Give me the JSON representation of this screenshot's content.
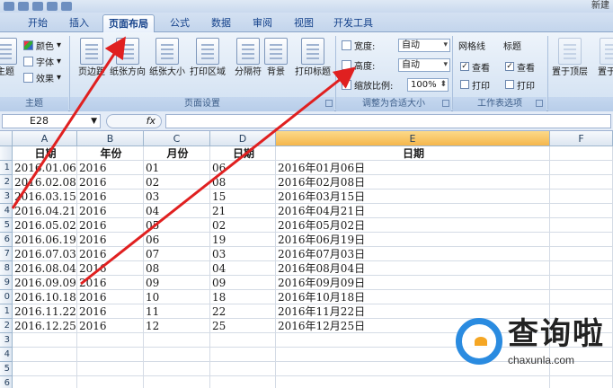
{
  "titlebar": {
    "title": "新建"
  },
  "tabs": [
    {
      "label": "开始"
    },
    {
      "label": "插入"
    },
    {
      "label": "页面布局",
      "active": true
    },
    {
      "label": "公式"
    },
    {
      "label": "数据"
    },
    {
      "label": "审阅"
    },
    {
      "label": "视图"
    },
    {
      "label": "开发工具"
    }
  ],
  "ribbon": {
    "theme": {
      "big_label": "主题",
      "colors": "颜色",
      "fonts": "字体",
      "effects": "效果",
      "group": "主题"
    },
    "page_setup": {
      "buttons": [
        "页边距",
        "纸张方向",
        "纸张大小",
        "打印区域",
        "分隔符",
        "背景",
        "打印标题"
      ],
      "group": "页面设置"
    },
    "scale": {
      "width_label": "宽度:",
      "width_value": "自动",
      "height_label": "高度:",
      "height_value": "自动",
      "zoom_label": "缩放比例:",
      "zoom_value": "100%",
      "group": "调整为合适大小"
    },
    "sheet_options": {
      "gridlines": "网格线",
      "headings": "标题",
      "view": "查看",
      "print": "打印",
      "group": "工作表选项"
    },
    "arrange": {
      "bring_front": "置于顶层",
      "send_back": "置于底"
    }
  },
  "formula_bar": {
    "name_box": "E28",
    "fx": "fx",
    "value": ""
  },
  "sheet": {
    "columns": [
      "A",
      "B",
      "C",
      "D",
      "E",
      "F"
    ],
    "header_row": [
      "日期",
      "年份",
      "月份",
      "日期",
      "日期",
      ""
    ],
    "rows": [
      [
        "2016.01.06",
        "2016",
        "01",
        "06",
        "2016年01月06日"
      ],
      [
        "2016.02.08",
        "2016",
        "02",
        "08",
        "2016年02月08日"
      ],
      [
        "2016.03.15",
        "2016",
        "03",
        "15",
        "2016年03月15日"
      ],
      [
        "2016.04.21",
        "2016",
        "04",
        "21",
        "2016年04月21日"
      ],
      [
        "2016.05.02",
        "2016",
        "05",
        "02",
        "2016年05月02日"
      ],
      [
        "2016.06.19",
        "2016",
        "06",
        "19",
        "2016年06月19日"
      ],
      [
        "2016.07.03",
        "2016",
        "07",
        "03",
        "2016年07月03日"
      ],
      [
        "2016.08.04",
        "2016",
        "08",
        "04",
        "2016年08月04日"
      ],
      [
        "2016.09.09",
        "2016",
        "09",
        "09",
        "2016年09月09日"
      ],
      [
        "2016.10.18",
        "2016",
        "10",
        "18",
        "2016年10月18日"
      ],
      [
        "2016.11.22",
        "2016",
        "11",
        "22",
        "2016年11月22日"
      ],
      [
        "2016.12.25",
        "2016",
        "12",
        "25",
        "2016年12月25日"
      ]
    ],
    "row_numbers": [
      "",
      "1",
      "2",
      "3",
      "4",
      "5",
      "6",
      "7",
      "8",
      "9",
      "0",
      "1",
      "2",
      "3",
      "4",
      "5",
      "6",
      "7"
    ]
  },
  "watermark": {
    "brand": "查询啦",
    "site": "chaxunla.com"
  },
  "colors": {
    "accent": "#2a8be0",
    "arrow": "#e02020",
    "selected_column": "#f5b74c"
  }
}
